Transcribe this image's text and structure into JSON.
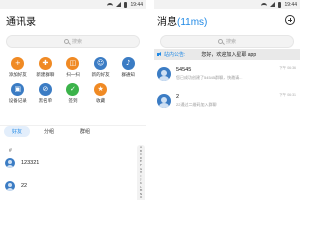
{
  "status_bar": {
    "time": "19:44"
  },
  "contacts_screen": {
    "title": "通讯录",
    "search_placeholder": "搜索",
    "grid": [
      {
        "label": "添加好友",
        "icon": "add-friend-icon",
        "color": "#f08a24",
        "glyph": "+"
      },
      {
        "label": "新建群聊",
        "icon": "group-chat-icon",
        "color": "#f08a24",
        "glyph": "✚"
      },
      {
        "label": "扫一扫",
        "icon": "scan-icon",
        "color": "#f08a24",
        "glyph": "◫"
      },
      {
        "label": "新的好友",
        "icon": "new-friend-icon",
        "color": "#3b7cc4",
        "glyph": "☺"
      },
      {
        "label": "群通知",
        "icon": "group-notice-icon",
        "color": "#3b7cc4",
        "glyph": "♪"
      },
      {
        "label": "设备记录",
        "icon": "device-icon",
        "color": "#3b7cc4",
        "glyph": "▣"
      },
      {
        "label": "黑名单",
        "icon": "blacklist-icon",
        "color": "#3b7cc4",
        "glyph": "⊘"
      },
      {
        "label": "签到",
        "icon": "sign-in-icon",
        "color": "#3bb34a",
        "glyph": "✓"
      },
      {
        "label": "收藏",
        "icon": "favorites-icon",
        "color": "#f08a24",
        "glyph": "★"
      }
    ],
    "tabs": [
      {
        "label": "好友",
        "active": true
      },
      {
        "label": "分组",
        "active": false
      },
      {
        "label": "群组",
        "active": false
      }
    ],
    "section_label": "#",
    "contacts": [
      {
        "name": "123321"
      },
      {
        "name": "22"
      }
    ],
    "alphabet": [
      "A",
      "B",
      "C",
      "D",
      "E",
      "F",
      "G",
      "H",
      "I",
      "J",
      "K",
      "L",
      "M",
      "N",
      "O",
      "P",
      "Q"
    ]
  },
  "messages_screen": {
    "title": "消息",
    "latency": "(11ms)",
    "notice_label": "站内公告:",
    "notice_text": "您好，欢迎加入星耶 app",
    "messages": [
      {
        "title": "54545",
        "preview": "您已成功创建了54545群聊，快邀请...",
        "time": "下午 06:36"
      },
      {
        "title": "2",
        "preview": "22通过二维码加入群聊",
        "time": "下午 06:31"
      }
    ]
  }
}
